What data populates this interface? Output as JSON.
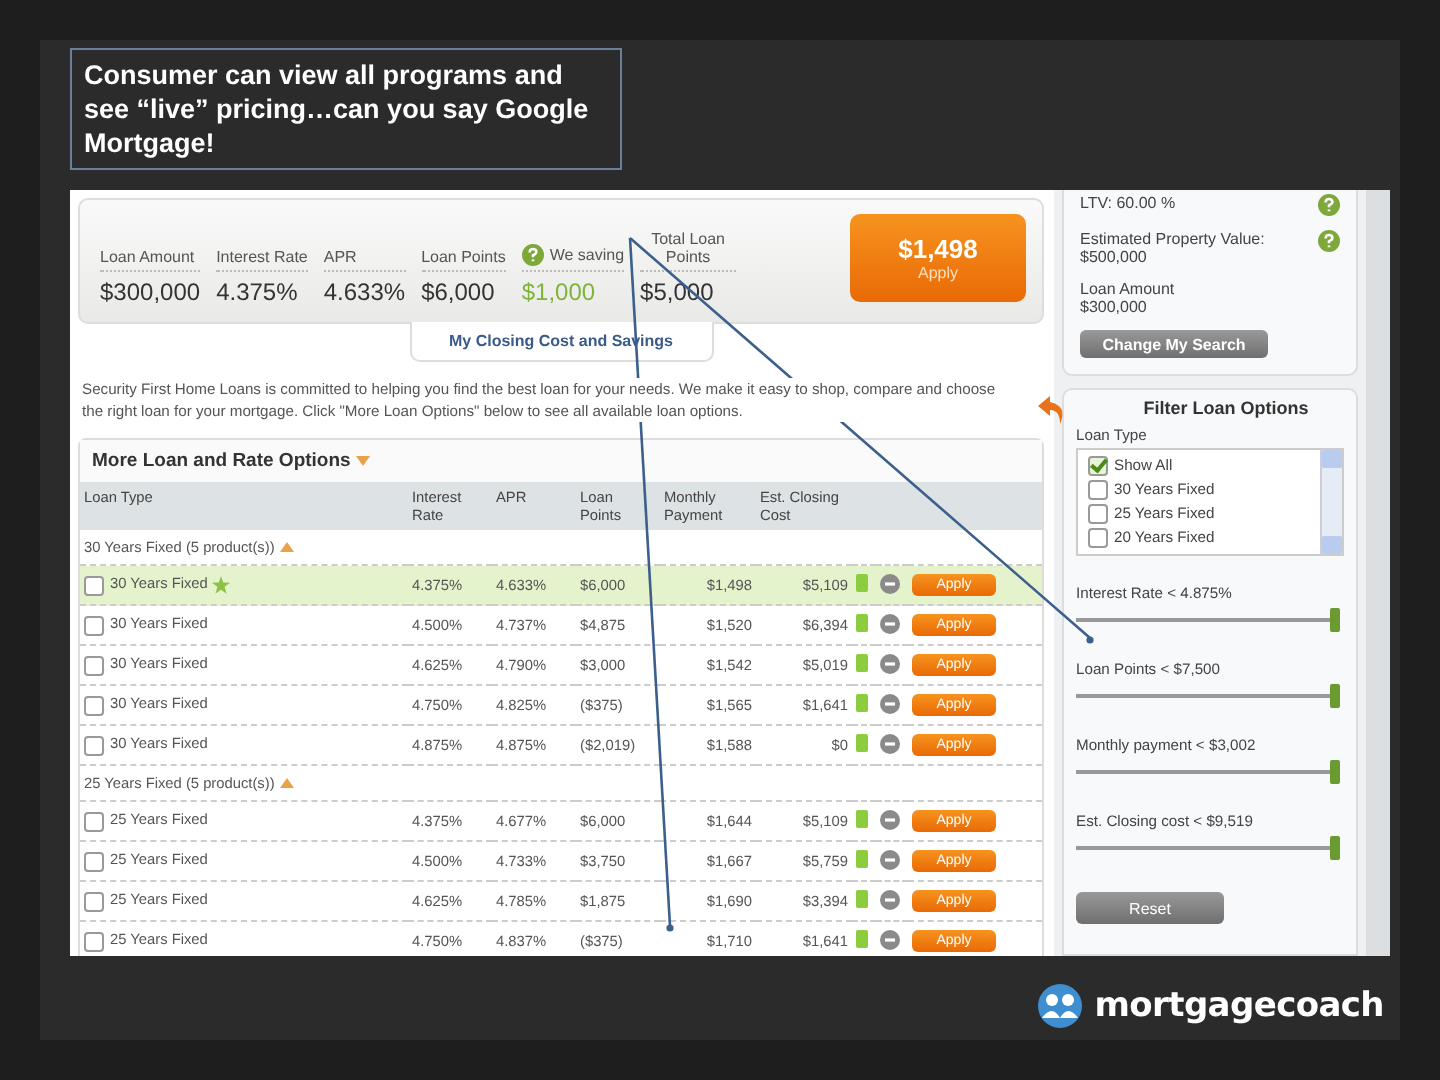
{
  "caption": "Consumer can view all programs and see “live” pricing…can you say Google Mortgage!",
  "summary": {
    "items": [
      {
        "label": "Loan Amount",
        "value": "$300,000"
      },
      {
        "label": "Interest Rate",
        "value": "4.375%"
      },
      {
        "label": "APR",
        "value": "4.633%"
      },
      {
        "label": "Loan Points",
        "value": "$6,000"
      }
    ],
    "savings": {
      "label": "We saving",
      "value": "$1,000"
    },
    "total_points": {
      "label": "Total Loan Points",
      "value": "$5,000"
    },
    "price": {
      "value": "$1,498",
      "action": "Apply"
    }
  },
  "closing_link": "My Closing Cost and Savings",
  "intro": "Security First Home Loans is committed to helping you find the best loan for your needs. We make it easy to shop, compare and choose the right loan for your mortgage. Click \"More Loan Options\" below to see all available loan options.",
  "options": {
    "title": "More Loan and Rate Options",
    "columns": [
      "Loan Type",
      "Interest Rate",
      "APR",
      "Loan Points",
      "Monthly Payment",
      "Est. Closing Cost"
    ],
    "groups": [
      {
        "title": "30 Years Fixed (5 product(s))",
        "expanded": true,
        "rows": [
          {
            "loan_type": "30 Years Fixed",
            "starred": true,
            "selected": true,
            "checked": false,
            "rate": "4.375%",
            "apr": "4.633%",
            "points": "$6,000",
            "payment": "$1,498",
            "closing_cost": "$5,109",
            "action": "Apply"
          },
          {
            "loan_type": "30 Years Fixed",
            "starred": false,
            "selected": false,
            "checked": false,
            "rate": "4.500%",
            "apr": "4.737%",
            "points": "$4,875",
            "payment": "$1,520",
            "closing_cost": "$6,394",
            "action": "Apply"
          },
          {
            "loan_type": "30 Years Fixed",
            "starred": false,
            "selected": false,
            "checked": false,
            "rate": "4.625%",
            "apr": "4.790%",
            "points": "$3,000",
            "payment": "$1,542",
            "closing_cost": "$5,019",
            "action": "Apply"
          },
          {
            "loan_type": "30 Years Fixed",
            "starred": false,
            "selected": false,
            "checked": false,
            "rate": "4.750%",
            "apr": "4.825%",
            "points": "($375)",
            "payment": "$1,565",
            "closing_cost": "$1,641",
            "action": "Apply"
          },
          {
            "loan_type": "30 Years Fixed",
            "starred": false,
            "selected": false,
            "checked": false,
            "rate": "4.875%",
            "apr": "4.875%",
            "points": "($2,019)",
            "payment": "$1,588",
            "closing_cost": "$0",
            "action": "Apply"
          }
        ]
      },
      {
        "title": "25 Years Fixed (5 product(s))",
        "expanded": true,
        "rows": [
          {
            "loan_type": "25 Years Fixed",
            "starred": false,
            "selected": false,
            "checked": false,
            "rate": "4.375%",
            "apr": "4.677%",
            "points": "$6,000",
            "payment": "$1,644",
            "closing_cost": "$5,109",
            "action": "Apply"
          },
          {
            "loan_type": "25 Years Fixed",
            "starred": false,
            "selected": false,
            "checked": false,
            "rate": "4.500%",
            "apr": "4.733%",
            "points": "$3,750",
            "payment": "$1,667",
            "closing_cost": "$5,759",
            "action": "Apply"
          },
          {
            "loan_type": "25 Years Fixed",
            "starred": false,
            "selected": false,
            "checked": false,
            "rate": "4.625%",
            "apr": "4.785%",
            "points": "$1,875",
            "payment": "$1,690",
            "closing_cost": "$3,394",
            "action": "Apply"
          },
          {
            "loan_type": "25 Years Fixed",
            "starred": false,
            "selected": false,
            "checked": false,
            "rate": "4.750%",
            "apr": "4.837%",
            "points": "($375)",
            "payment": "$1,710",
            "closing_cost": "$1,641",
            "action": "Apply"
          }
        ]
      }
    ]
  },
  "side_info": [
    {
      "label": "LTV: 60.00 %",
      "help": true
    },
    {
      "label": "Estimated Property Value:",
      "value": "$500,000",
      "help": true
    },
    {
      "label": "Loan Amount",
      "value": "$300,000",
      "help": false
    }
  ],
  "change_button": "Change My Search",
  "filter": {
    "title": "Filter Loan Options",
    "loan_type_label": "Loan Type",
    "types": [
      {
        "label": "Show All",
        "checked": true
      },
      {
        "label": "30 Years Fixed",
        "checked": false
      },
      {
        "label": "25 Years Fixed",
        "checked": false
      },
      {
        "label": "20 Years Fixed",
        "checked": false
      }
    ],
    "sliders": [
      {
        "label": "Interest Rate < 4.875%",
        "level": 1
      },
      {
        "label": "Loan Points < $7,500",
        "level": 1
      },
      {
        "label": "Monthly payment < $3,002",
        "level": 1
      },
      {
        "label": "Est. Closing cost < $9,519",
        "level": 1
      }
    ],
    "reset": "Reset"
  },
  "logo": "mortgagecoach"
}
